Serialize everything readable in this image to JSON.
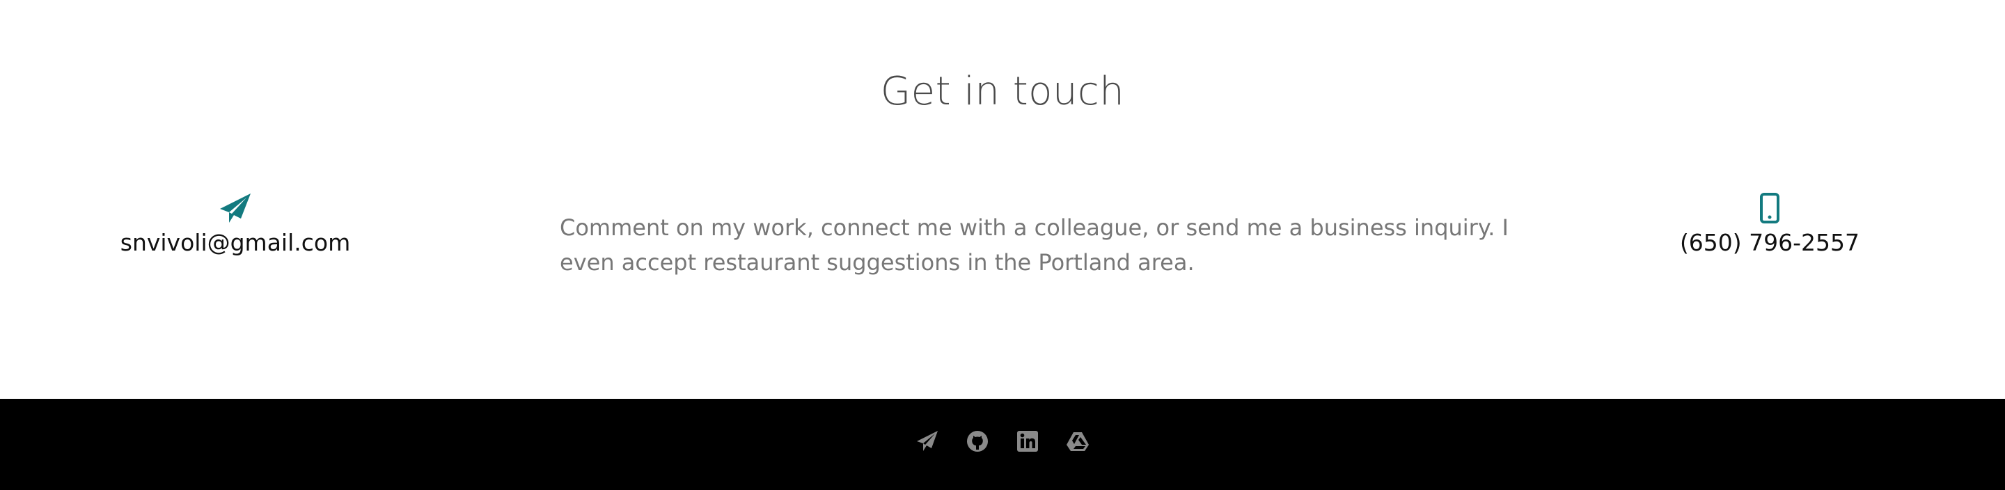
{
  "contact": {
    "heading": "Get in touch",
    "email": "snvivoli@gmail.com",
    "email_icon": "paper-plane-icon",
    "message": "Comment on my work, connect me with a colleague, or send me a business inquiry. I even accept restaurant suggestions in the Portland area.",
    "phone": "(650) 796-2557",
    "phone_icon": "mobile-phone-icon",
    "accent_color": "#137a7f"
  },
  "footer": {
    "background": "#000000",
    "icon_color": "#8a8a8a",
    "icons": [
      "paper-plane-icon",
      "github-icon",
      "linkedin-icon",
      "google-drive-icon"
    ]
  }
}
